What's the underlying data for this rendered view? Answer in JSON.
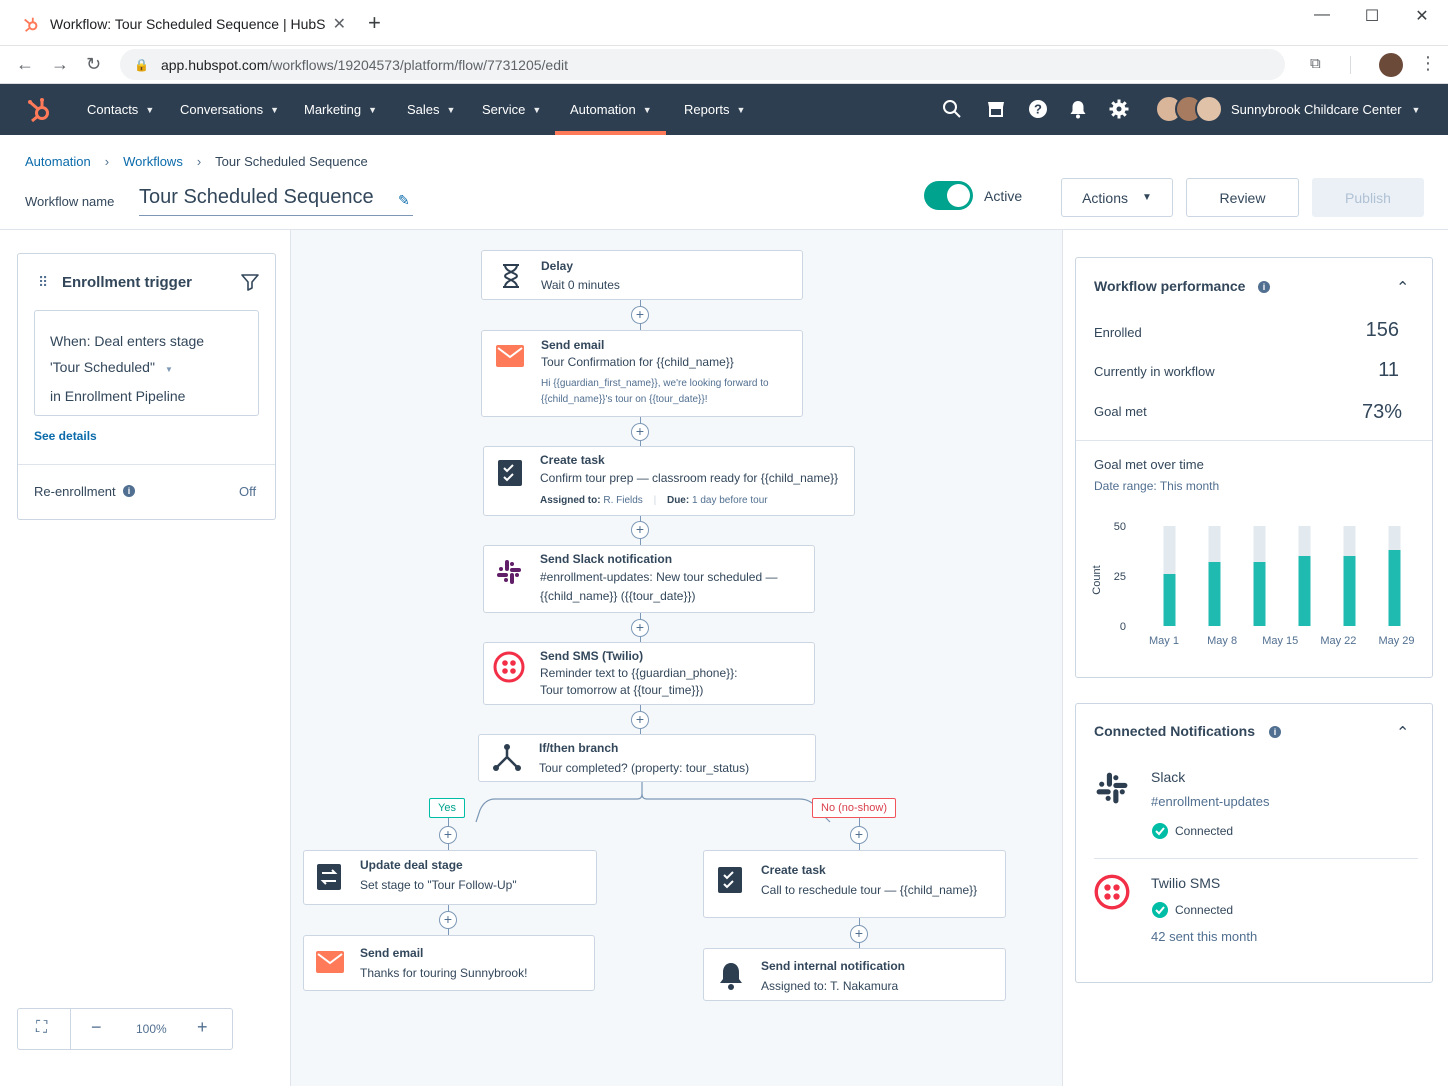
{
  "browser": {
    "tab_title": "Workflow: Tour Scheduled Sequence | HubSpot",
    "url_host": "app.hubspot.com",
    "url_path": "/workflows/19204573/platform/flow/7731205/edit"
  },
  "nav": {
    "items": [
      "Contacts",
      "Conversations",
      "Marketing",
      "Sales",
      "Service",
      "Automation",
      "Reports"
    ],
    "active": "Automation",
    "account": "Sunnybrook Childcare Center"
  },
  "breadcrumb": [
    "Automation",
    "Workflows",
    "Tour Scheduled Sequence"
  ],
  "header": {
    "workflow_name_label": "Workflow name",
    "workflow_name": "Tour Scheduled Sequence",
    "status": "Active",
    "actions": "Actions",
    "review": "Review",
    "publish": "Publish"
  },
  "trigger": {
    "title": "Enrollment trigger",
    "line1": "When: Deal enters stage",
    "line2": "'Tour Scheduled\"",
    "line3": "in Enrollment Pipeline",
    "see_details": "See details",
    "reenroll_label": "Re-enrollment",
    "reenroll_value": "Off"
  },
  "zoom": {
    "level": "100%"
  },
  "nodes": {
    "delay": {
      "title": "Delay",
      "sub": "Wait 0 minutes"
    },
    "email1": {
      "title": "Send email",
      "sub": "Tour Confirmation for {{child_name}}",
      "preview1": "Hi {{guardian_first_name}}, we're looking forward to",
      "preview2": "{{child_name}}'s tour on {{tour_date}}!"
    },
    "task1": {
      "title": "Create task",
      "sub": "Confirm tour prep — classroom ready for {{child_name}}",
      "assigned_label": "Assigned to:",
      "assigned": "R. Fields",
      "due_label": "Due:",
      "due": "1 day before tour"
    },
    "slack": {
      "title": "Send Slack notification",
      "sub1": "#enrollment-updates: New tour scheduled —",
      "sub2": "{{child_name}} ({{tour_date}})"
    },
    "sms": {
      "title": "Send SMS (Twilio)",
      "sub1": "Reminder text to {{guardian_phone}}:",
      "sub2": "Tour tomorrow at {{tour_time}})"
    },
    "branch": {
      "title": "If/then branch",
      "sub": "Tour completed? (property: tour_status)"
    },
    "yes_tag": "Yes",
    "no_tag": "No (no-show)",
    "deal": {
      "title": "Update deal stage",
      "sub": "Set stage to \"Tour Follow-Up\""
    },
    "email2": {
      "title": "Send email",
      "sub": "Thanks for touring Sunnybrook!"
    },
    "task2": {
      "title": "Create task",
      "sub": "Call to reschedule tour — {{child_name}}"
    },
    "internal": {
      "title": "Send internal notification",
      "sub": "Assigned to: T. Nakamura"
    }
  },
  "performance": {
    "title": "Workflow performance",
    "rows": [
      {
        "label": "Enrolled",
        "value": "156"
      },
      {
        "label": "Currently in workflow",
        "value": "11"
      },
      {
        "label": "Goal met",
        "value": "73%"
      }
    ],
    "chart_title": "Goal met over time",
    "date_range": "Date range: This month"
  },
  "chart_data": {
    "type": "bar",
    "categories": [
      "May 1",
      "May 8",
      "May 15",
      "May 22",
      "May 29"
    ],
    "series": [
      {
        "values": [
          26,
          32,
          32,
          35,
          35,
          38
        ]
      },
      {
        "values": [
          50,
          50,
          50,
          50,
          50,
          50
        ]
      }
    ],
    "ylabel": "Count",
    "ylim": [
      0,
      50
    ],
    "yticks": [
      "50",
      "25",
      "0"
    ],
    "colors": {
      "goal": "#1fbab0",
      "total": "#e2eaef"
    }
  },
  "notifications": {
    "title": "Connected Notifications",
    "slack_name": "Slack",
    "slack_channel": "#enrollment-updates",
    "slack_status": "Connected",
    "twilio_name": "Twilio SMS",
    "twilio_status": "Connected",
    "twilio_sent": "42 sent this month"
  }
}
